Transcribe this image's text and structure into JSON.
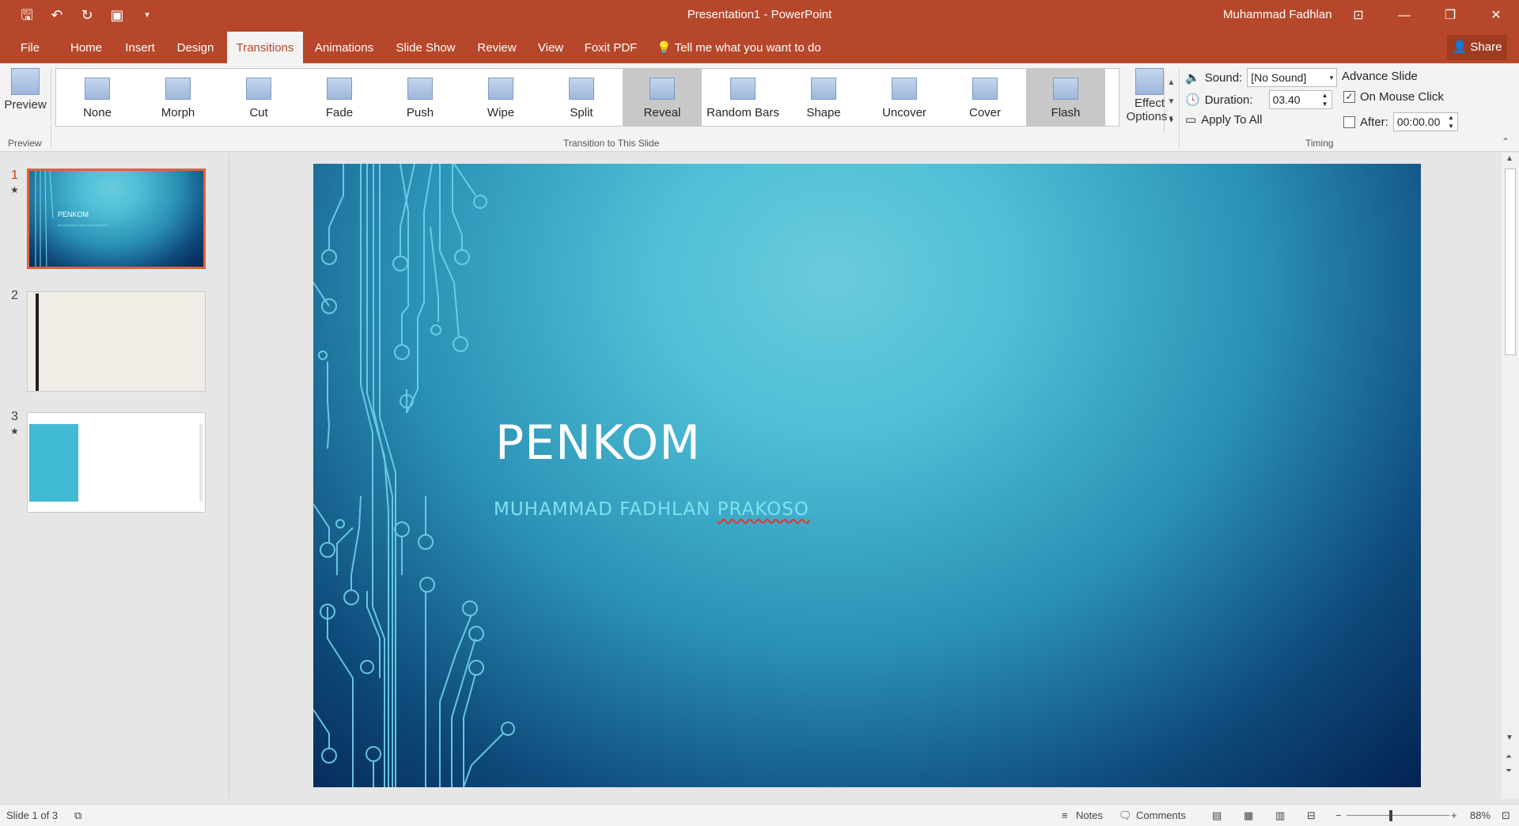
{
  "window": {
    "title": "Presentation1  -  PowerPoint",
    "user": "Muhammad Fadhlan",
    "qat_icons": [
      "save-icon",
      "undo-icon",
      "redo-icon",
      "start-slideshow-icon",
      "customize-icon"
    ]
  },
  "tabs": [
    {
      "label": "File"
    },
    {
      "label": "Home"
    },
    {
      "label": "Insert"
    },
    {
      "label": "Design"
    },
    {
      "label": "Transitions",
      "active": true
    },
    {
      "label": "Animations"
    },
    {
      "label": "Slide Show"
    },
    {
      "label": "Review"
    },
    {
      "label": "View"
    },
    {
      "label": "Foxit PDF"
    }
  ],
  "tell_me": "Tell me what you want to do",
  "share_label": "Share",
  "ribbon": {
    "preview_label": "Preview",
    "preview_group": "Preview",
    "transitions_group": "Transition to This Slide",
    "transitions": [
      {
        "label": "None"
      },
      {
        "label": "Morph"
      },
      {
        "label": "Cut"
      },
      {
        "label": "Fade"
      },
      {
        "label": "Push"
      },
      {
        "label": "Wipe"
      },
      {
        "label": "Split"
      },
      {
        "label": "Reveal",
        "selected": true
      },
      {
        "label": "Random Bars"
      },
      {
        "label": "Shape"
      },
      {
        "label": "Uncover"
      },
      {
        "label": "Cover"
      },
      {
        "label": "Flash",
        "selected": true
      }
    ],
    "effect_options_line1": "Effect",
    "effect_options_line2": "Options",
    "timing": {
      "sound_label": "Sound:",
      "sound_value": "[No Sound]",
      "duration_label": "Duration:",
      "duration_value": "03.40",
      "apply_all": "Apply To All",
      "advance_label": "Advance Slide",
      "on_mouse_click": "On Mouse Click",
      "on_mouse_click_checked": true,
      "after_label": "After:",
      "after_value": "00:00.00",
      "after_checked": false,
      "group_label": "Timing"
    }
  },
  "thumbnails": [
    {
      "number": "1",
      "star": "★",
      "selected": true,
      "title": "PENKOM",
      "subtitle": "MUHAMMAD FADHLAN PRAKOSO"
    },
    {
      "number": "2",
      "star": "",
      "selected": false
    },
    {
      "number": "3",
      "star": "★",
      "selected": false
    }
  ],
  "slide": {
    "title": "PENKOM",
    "subtitle_main": "MUHAMMAD FADHLAN ",
    "subtitle_flagged": "PRAKOSO"
  },
  "status": {
    "slide_info": "Slide 1 of 3",
    "notes": "Notes",
    "comments": "Comments",
    "zoom": "88%"
  },
  "colors": {
    "accent": "#b7472a",
    "selection": "#e3603a"
  }
}
